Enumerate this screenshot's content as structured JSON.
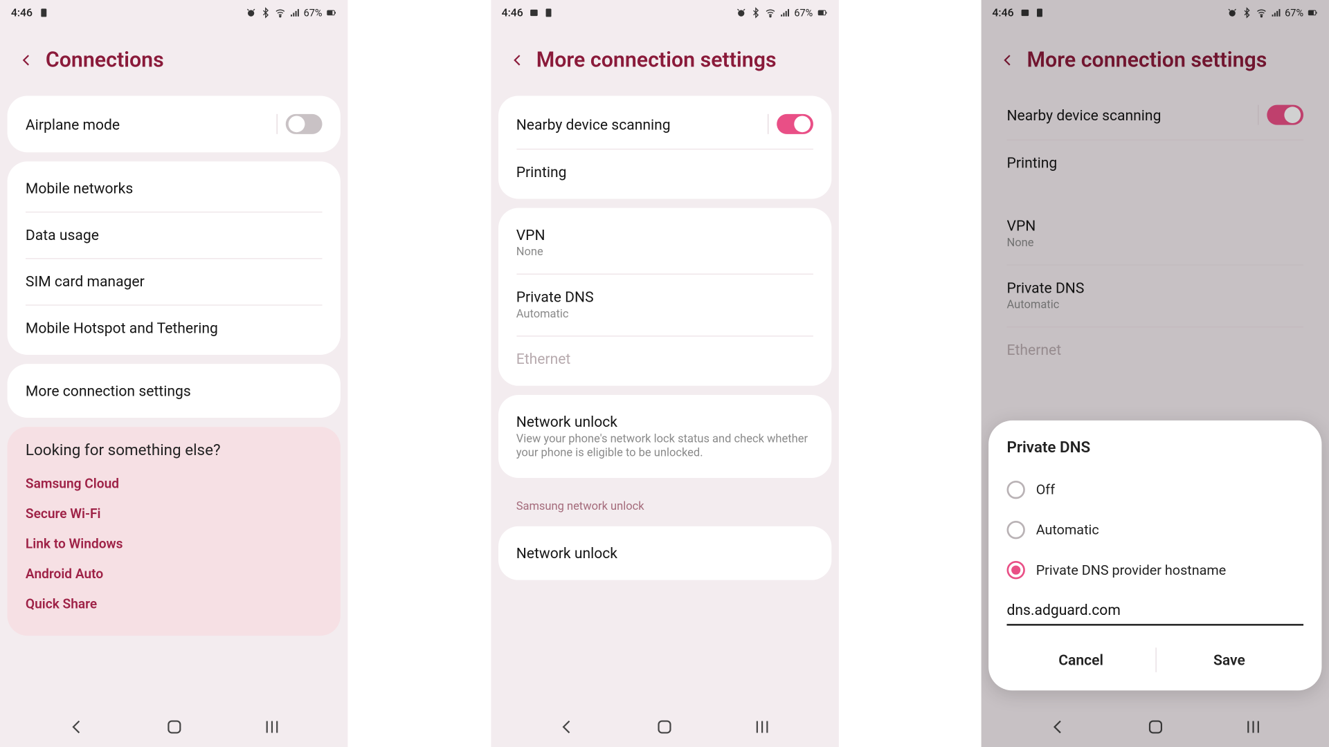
{
  "status": {
    "time": "4:46",
    "battery_pct": "67%"
  },
  "screen1": {
    "title": "Connections",
    "airplane": {
      "label": "Airplane mode",
      "on": false
    },
    "group2": [
      {
        "label": "Mobile networks"
      },
      {
        "label": "Data usage"
      },
      {
        "label": "SIM card manager"
      },
      {
        "label": "Mobile Hotspot and Tethering"
      }
    ],
    "more": {
      "label": "More connection settings"
    },
    "looking": {
      "header": "Looking for something else?",
      "links": [
        "Samsung Cloud",
        "Secure Wi-Fi",
        "Link to Windows",
        "Android Auto",
        "Quick Share"
      ]
    }
  },
  "screen2": {
    "title": "More connection settings",
    "nearby": {
      "label": "Nearby device scanning",
      "on": true
    },
    "printing": {
      "label": "Printing"
    },
    "vpn": {
      "label": "VPN",
      "sub": "None"
    },
    "private_dns": {
      "label": "Private DNS",
      "sub": "Automatic"
    },
    "ethernet": {
      "label": "Ethernet"
    },
    "network_unlock": {
      "label": "Network unlock",
      "sub": "View your phone's network lock status and check whether your phone is eligible to be unlocked."
    },
    "samsung_unlock_header": "Samsung network unlock",
    "samsung_unlock": {
      "label": "Network unlock"
    }
  },
  "dialog": {
    "title": "Private DNS",
    "options": [
      {
        "label": "Off",
        "selected": false
      },
      {
        "label": "Automatic",
        "selected": false
      },
      {
        "label": "Private DNS provider hostname",
        "selected": true
      }
    ],
    "hostname": "dns.adguard.com",
    "cancel": "Cancel",
    "save": "Save"
  }
}
